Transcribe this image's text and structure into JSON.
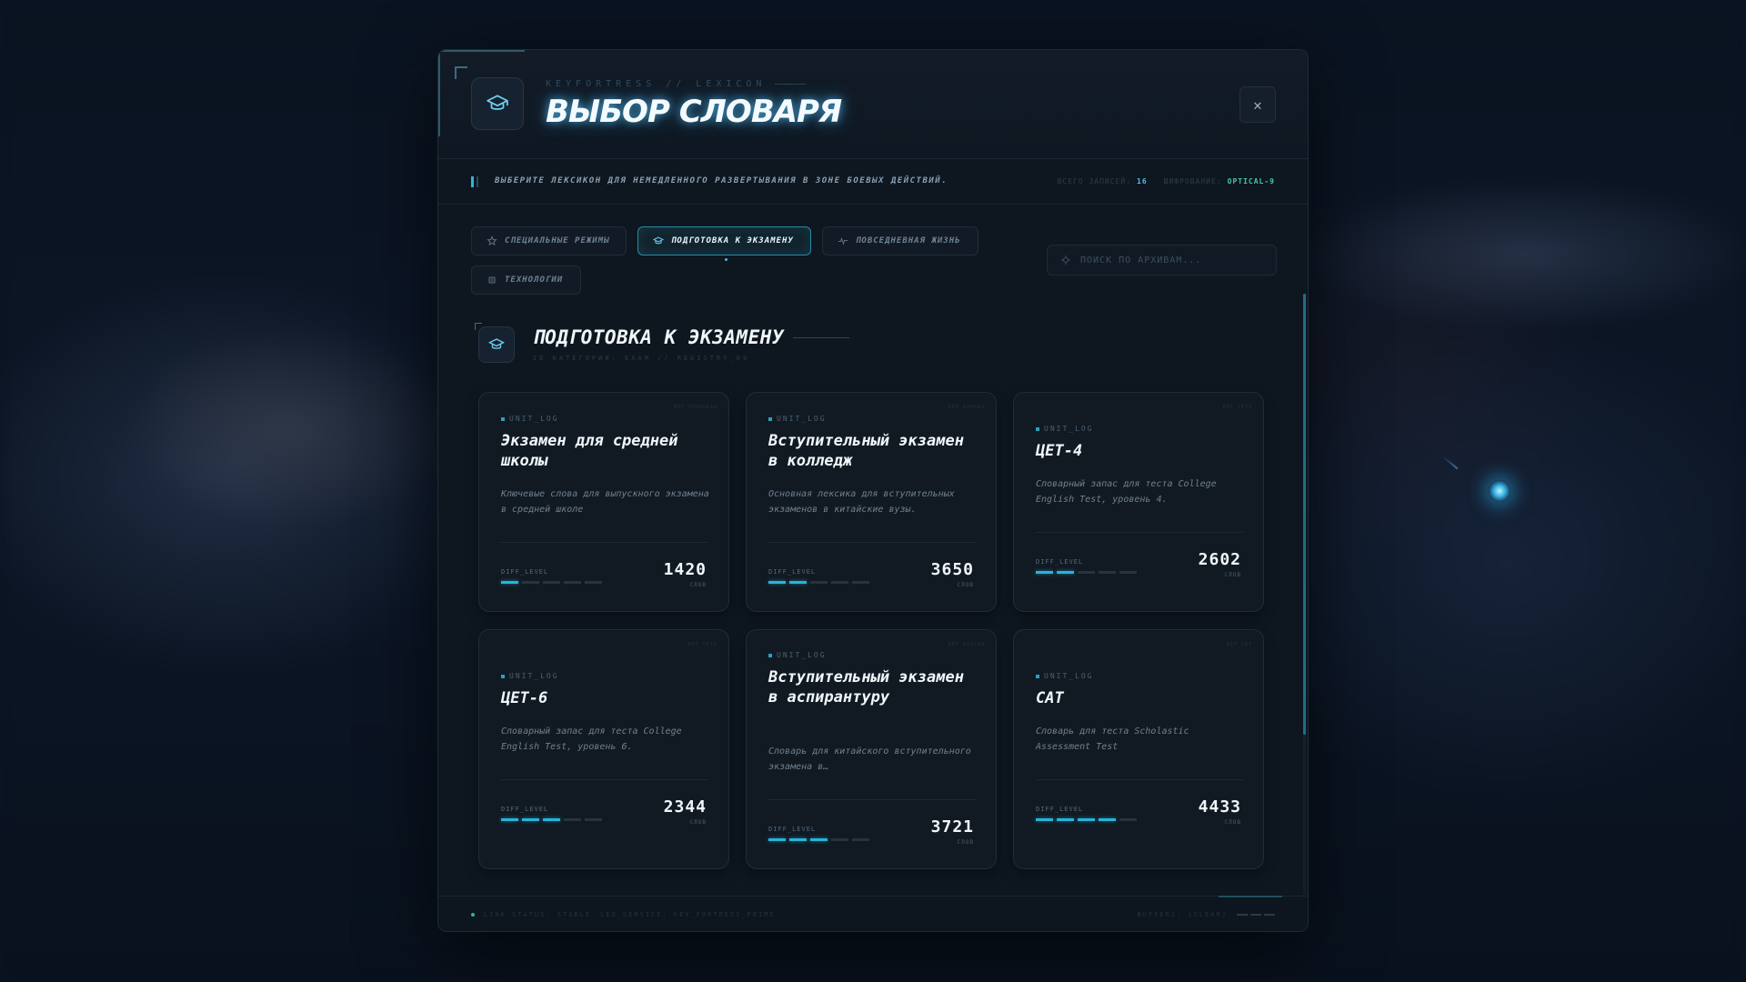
{
  "header": {
    "brand": "KEYFORTRESS // LEXICON",
    "title": "ВЫБОР СЛОВАРЯ",
    "close_label": "✕"
  },
  "notice": {
    "text": "ВЫБЕРИТЕ ЛЕКСИКОН ДЛЯ НЕМЕДЛЕННОГО РАЗВЕРТЫВАНИЯ В ЗОНЕ БОЕВЫХ ДЕЙСТВИЙ.",
    "total_label": "ВСЕГО ЗАПИСЕЙ:",
    "total_value": "16",
    "encryption_label": "ШИФРОВАНИЕ:",
    "encryption_value": "OPTICAL-9"
  },
  "tabs": [
    {
      "label": "СПЕЦИАЛЬНЫЕ РЕЖИМЫ",
      "icon": "star-icon",
      "active": false
    },
    {
      "label": "ПОДГОТОВКА К ЭКЗАМЕНУ",
      "icon": "graduation-cap-icon",
      "active": true
    },
    {
      "label": "ПОВСЕДНЕВНАЯ ЖИЗНЬ",
      "icon": "pulse-icon",
      "active": false
    },
    {
      "label": "ТЕХНОЛОГИИ",
      "icon": "chip-icon",
      "active": false
    }
  ],
  "search": {
    "placeholder": "ПОИСК ПО АРХИВАМ..."
  },
  "section": {
    "title": "ПОДГОТОВКА К ЭКЗАМЕНУ",
    "subtitle": "ID КАТЕГОРИИ: EXAM // REGISTRY_09"
  },
  "cards": [
    {
      "tag": "REF_ZHONGKAO",
      "unit": "UNIT_LOG",
      "title": "Экзамен для средней школы",
      "desc": "Ключевые слова для выпускного экзамена в средней школе",
      "diff_label": "DIFF_LEVEL",
      "difficulty": 1,
      "count": "1420",
      "count_label": "СЛОВ"
    },
    {
      "tag": "REF_GAOKAO",
      "unit": "UNIT_LOG",
      "title": "Вступительный экзамен в колледж",
      "desc": "Основная лексика для вступительных экзаменов в китайские вузы.",
      "diff_label": "DIFF_LEVEL",
      "difficulty": 2,
      "count": "3650",
      "count_label": "СЛОВ"
    },
    {
      "tag": "REF_CET4",
      "unit": "UNIT_LOG",
      "title": "ЦЕТ-4",
      "desc": "Словарный запас для теста College English Test, уровень 4.",
      "diff_label": "DIFF_LEVEL",
      "difficulty": 2,
      "count": "2602",
      "count_label": "СЛОВ"
    },
    {
      "tag": "REF_CET6",
      "unit": "UNIT_LOG",
      "title": "ЦЕТ-6",
      "desc": "Словарный запас для теста College English Test, уровень 6.",
      "diff_label": "DIFF_LEVEL",
      "difficulty": 3,
      "count": "2344",
      "count_label": "СЛОВ"
    },
    {
      "tag": "REF_KAOYAN",
      "unit": "UNIT_LOG",
      "title": "Вступительный экзамен в аспирантуру",
      "desc": "Словарь для китайского вступительного экзамена в…",
      "diff_label": "DIFF_LEVEL",
      "difficulty": 3,
      "count": "3721",
      "count_label": "СЛОВ"
    },
    {
      "tag": "REF_SAT",
      "unit": "UNIT_LOG",
      "title": "САТ",
      "desc": "Словарь для теста Scholastic Assessment Test",
      "diff_label": "DIFF_LEVEL",
      "difficulty": 4,
      "count": "4433",
      "count_label": "СЛОВ"
    }
  ],
  "footer": {
    "status": "LINK_STATUS: STABLE",
    "service": "LEX_SERVICE: KEY_FORTRESS_PRIME",
    "buffers": "BUFFERS: [CLEAR]"
  },
  "colors": {
    "accent": "#27b4d8",
    "background": "#0e1620",
    "text": "#f2f7fb"
  }
}
